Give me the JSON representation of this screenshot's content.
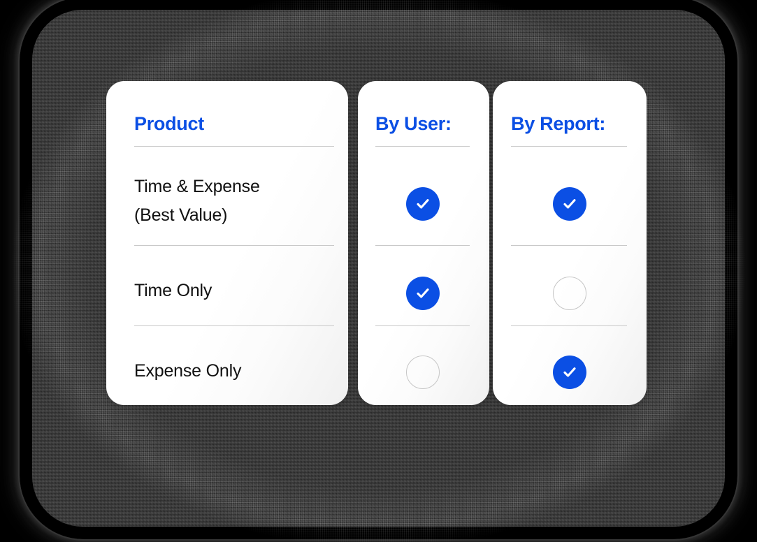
{
  "theme": {
    "accent": "#0b4fe4",
    "card_bg": "#ffffff",
    "backdrop": "#3c3c3c",
    "divider": "#c9c9c9",
    "empty_circle_border": "#c6c6c6",
    "text": "#111111"
  },
  "table": {
    "columns": [
      {
        "id": "product",
        "label": "Product",
        "type": "label"
      },
      {
        "id": "by_user",
        "label": "By User:",
        "type": "check"
      },
      {
        "id": "by_report",
        "label": "By Report:",
        "type": "check"
      }
    ],
    "rows": [
      {
        "id": "time-and-expense",
        "label_line_1": "Time & Expense",
        "label_line_2": "(Best Value)",
        "by_user": "checked",
        "by_report": "checked"
      },
      {
        "id": "time-only",
        "label_line_1": "Time Only",
        "label_line_2": "",
        "by_user": "checked",
        "by_report": "unchecked"
      },
      {
        "id": "expense-only",
        "label_line_1": "Expense Only",
        "label_line_2": "",
        "by_user": "unchecked",
        "by_report": "checked"
      }
    ]
  },
  "icons": {
    "checked": "check-circle-filled-icon",
    "unchecked": "circle-empty-icon"
  }
}
